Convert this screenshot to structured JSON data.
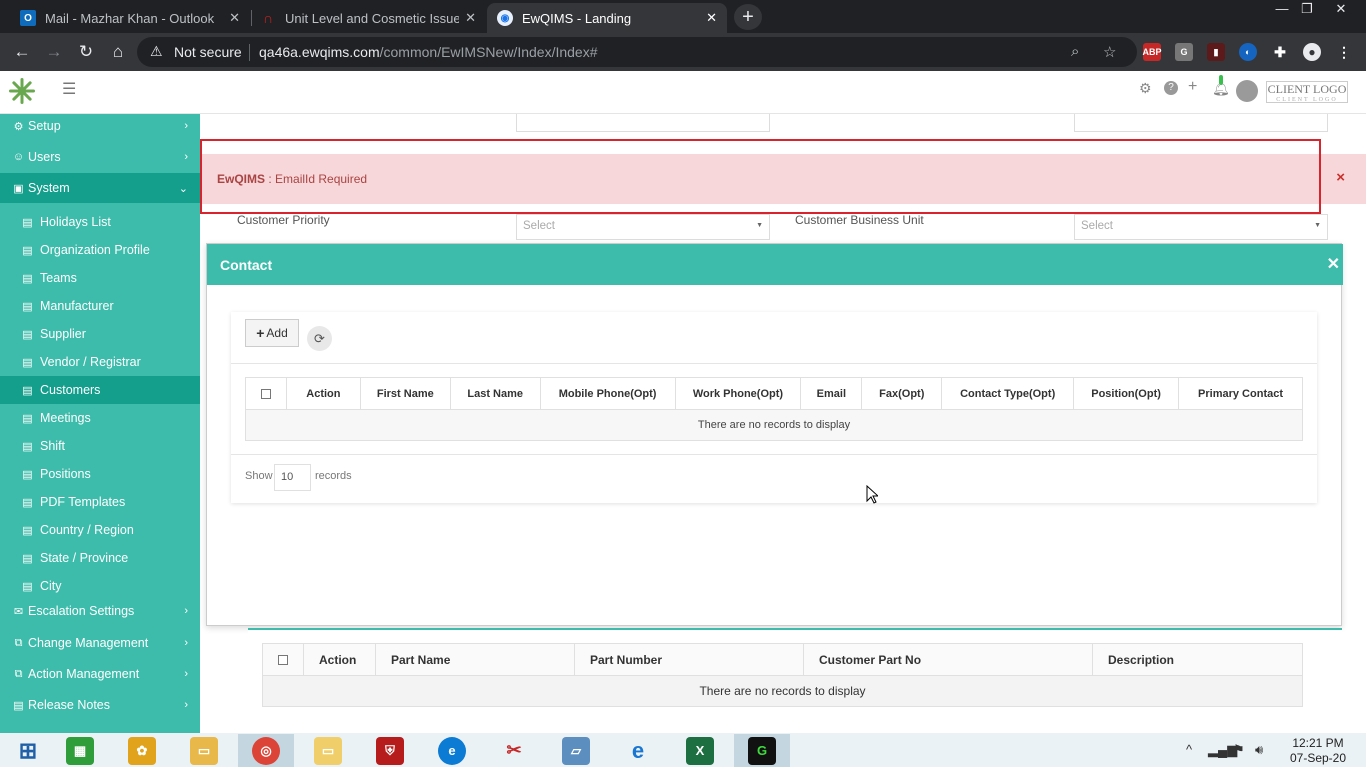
{
  "browser": {
    "tabs": [
      {
        "title": "Mail - Mazhar Khan - Outlook",
        "icon": "outlook-icon",
        "color": "#0f6cbd",
        "active": false
      },
      {
        "title": "Unit Level and Cosmetic Issues #",
        "icon": "headset-icon",
        "color": "#c5221f",
        "active": false
      },
      {
        "title": "EwQIMS - Landing",
        "icon": "globe-icon",
        "color": "#1a73e8",
        "active": true
      }
    ],
    "security": "Not secure",
    "url_host": "qa46a.ewqims.com",
    "url_path": "/common/EwIMSNew/Index/Index#",
    "extensions": [
      "ABP",
      "G"
    ]
  },
  "header": {
    "client_logo": "CLIENT LOGO",
    "client_logo_sub": "CLIENT LOGO"
  },
  "sidebar": {
    "top": [
      {
        "label": "Setup",
        "icon": "gear-icon"
      },
      {
        "label": "Users",
        "icon": "user-icon"
      },
      {
        "label": "System",
        "icon": "system-icon",
        "expanded": true
      }
    ],
    "system_items": [
      "Holidays List",
      "Organization Profile",
      "Teams",
      "Manufacturer",
      "Supplier",
      "Vendor / Registrar",
      "Customers",
      "Meetings",
      "Shift",
      "Positions",
      "PDF Templates",
      "Country / Region",
      "State / Province",
      "City"
    ],
    "active_item": "Customers",
    "bottom": [
      {
        "label": "Escalation Settings",
        "icon": "envelope-icon"
      },
      {
        "label": "Change Management",
        "icon": "sitemap-icon"
      },
      {
        "label": "Action Management",
        "icon": "sitemap-icon"
      },
      {
        "label": "Release Notes",
        "icon": "document-icon"
      }
    ]
  },
  "form": {
    "customer_priority_label": "Customer Priority",
    "customer_priority_value": "Select",
    "customer_business_unit_label": "Customer Business Unit",
    "customer_business_unit_value": "Select"
  },
  "alert": {
    "app": "EwQIMS",
    "message": " : EmailId Required"
  },
  "modal": {
    "title": "Contact",
    "add_label": "Add",
    "columns": [
      "Action",
      "First Name",
      "Last Name",
      "Mobile Phone(Opt)",
      "Work Phone(Opt)",
      "Email",
      "Fax(Opt)",
      "Contact Type(Opt)",
      "Position(Opt)",
      "Primary Contact"
    ],
    "empty": "There are no records to display",
    "show_label": "Show",
    "page_size": "10",
    "records_label": "records"
  },
  "parts_table": {
    "columns": [
      "Action",
      "Part Name",
      "Part Number",
      "Customer Part No",
      "Description"
    ],
    "empty": "There are no records to display",
    "footer_ghost": "10 records"
  },
  "taskbar": {
    "time": "12:21 PM",
    "date": "07-Sep-20"
  },
  "colors": {
    "accent": "#3dbcab",
    "accent_dark": "#139f8c",
    "alert_bg": "#f8d7da",
    "alert_text": "#a94442",
    "highlight": "#d9232d"
  }
}
